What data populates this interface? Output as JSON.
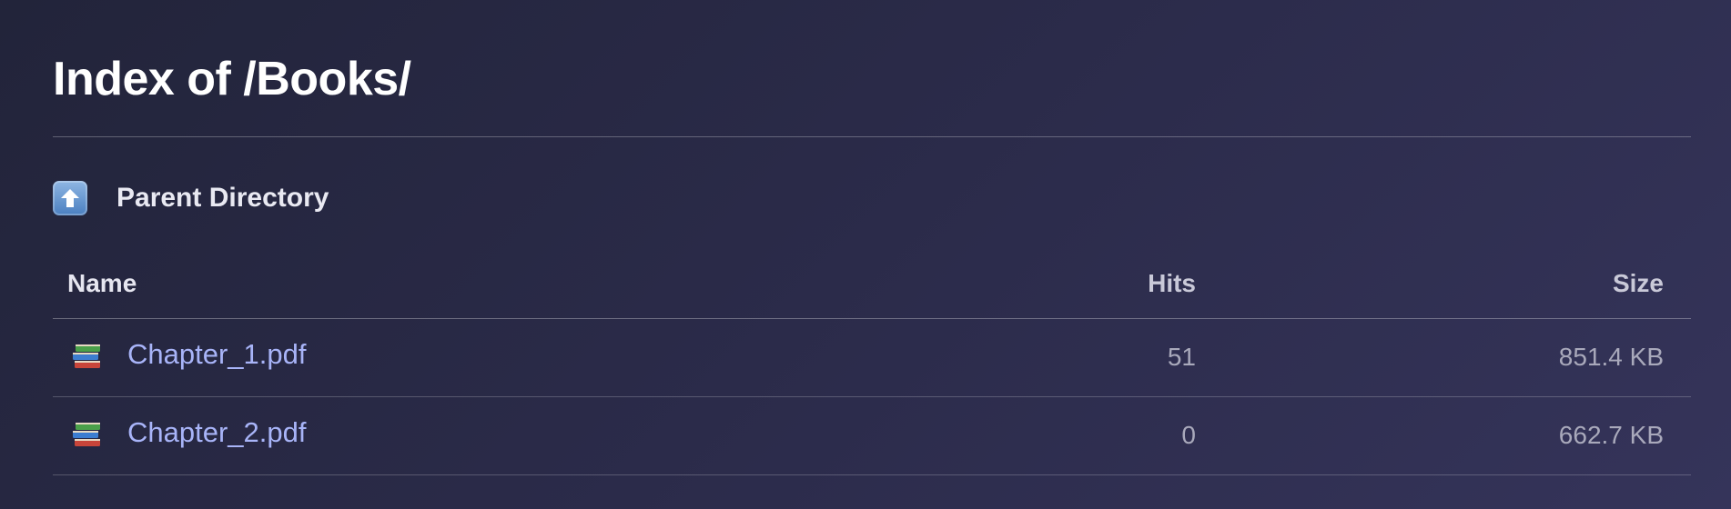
{
  "page": {
    "title": "Index of /Books/"
  },
  "parent": {
    "label": "Parent Directory",
    "icon": "up-arrow-icon"
  },
  "table": {
    "headers": {
      "name": "Name",
      "hits": "Hits",
      "size": "Size"
    },
    "rows": [
      {
        "icon": "books-icon",
        "name": "Chapter_1.pdf",
        "hits": "51",
        "size": "851.4 KB"
      },
      {
        "icon": "books-icon",
        "name": "Chapter_2.pdf",
        "hits": "0",
        "size": "662.7 KB"
      }
    ]
  },
  "colors": {
    "link": "#a8b4f8",
    "muted": "#a9a9bb",
    "background_start": "#22243a",
    "background_end": "#35345a"
  }
}
